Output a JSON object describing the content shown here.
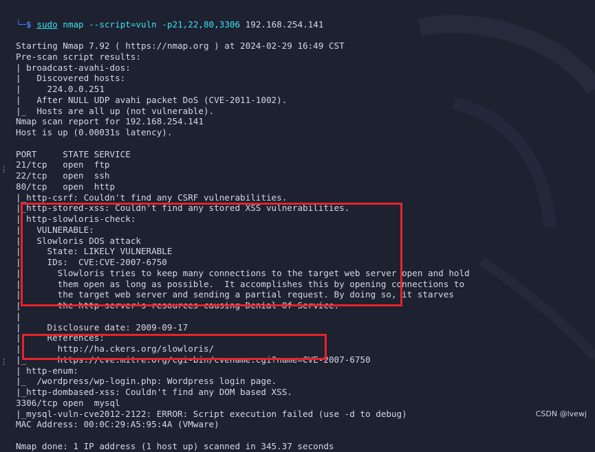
{
  "prompt": {
    "corner": "└─",
    "dollar": "$",
    "sudo": "sudo",
    "command": " nmap --script=vuln -p21,22,80,3306 ",
    "target": "192.168.254.141"
  },
  "lines": [
    {
      "prefix": "",
      "text": "Starting Nmap 7.92 ( https://nmap.org ) at 2024-02-29 16:49 CST"
    },
    {
      "prefix": "",
      "text": "Pre-scan script results:"
    },
    {
      "prefix": "| ",
      "text": "broadcast-avahi-dos:"
    },
    {
      "prefix": "|   ",
      "text": "Discovered hosts:"
    },
    {
      "prefix": "|     ",
      "text": "224.0.0.251"
    },
    {
      "prefix": "|   ",
      "text": "After NULL UDP avahi packet DoS (CVE-2011-1002)."
    },
    {
      "prefix": "|_  ",
      "text": "Hosts are all up (not vulnerable)."
    },
    {
      "prefix": "",
      "text": "Nmap scan report for 192.168.254.141"
    },
    {
      "prefix": "",
      "text": "Host is up (0.00031s latency)."
    },
    {
      "prefix": "",
      "text": ""
    },
    {
      "prefix": "",
      "text": "PORT     STATE SERVICE"
    },
    {
      "prefix": "",
      "text": "21/tcp   open  ftp"
    },
    {
      "prefix": "",
      "text": "22/tcp   open  ssh"
    },
    {
      "prefix": "",
      "text": "80/tcp   open  http"
    },
    {
      "prefix": "|_",
      "text": "http-csrf: Couldn't find any CSRF vulnerabilities."
    },
    {
      "prefix": "|_",
      "text": "http-stored-xss: Couldn't find any stored XSS vulnerabilities."
    },
    {
      "prefix": "| ",
      "text": "http-slowloris-check:"
    },
    {
      "prefix": "|   ",
      "text": "VULNERABLE:"
    },
    {
      "prefix": "|   ",
      "text": "Slowloris DOS attack"
    },
    {
      "prefix": "|     ",
      "text": "State: LIKELY VULNERABLE"
    },
    {
      "prefix": "|     ",
      "text": "IDs:  CVE:CVE-2007-6750"
    },
    {
      "prefix": "|       ",
      "text": "Slowloris tries to keep many connections to the target web server open and hold"
    },
    {
      "prefix": "|       ",
      "text": "them open as long as possible.  It accomplishes this by opening connections to"
    },
    {
      "prefix": "|       ",
      "text": "the target web server and sending a partial request. By doing so, it starves"
    },
    {
      "prefix": "|       ",
      "text": "the http server's resources causing Denial Of Service."
    },
    {
      "prefix": "|",
      "text": ""
    },
    {
      "prefix": "|     ",
      "text": "Disclosure date: 2009-09-17"
    },
    {
      "prefix": "|     ",
      "text": "References:"
    },
    {
      "prefix": "|       ",
      "text": "http://ha.ckers.org/slowloris/"
    },
    {
      "prefix": "|_      ",
      "text": "https://cve.mitre.org/cgi-bin/cvename.cgi?name=CVE-2007-6750"
    },
    {
      "prefix": "| ",
      "text": "http-enum:"
    },
    {
      "prefix": "|_  ",
      "text": "/wordpress/wp-login.php: Wordpress login page."
    },
    {
      "prefix": "|_",
      "text": "http-dombased-xss: Couldn't find any DOM based XSS."
    },
    {
      "prefix": "",
      "text": "3306/tcp open  mysql"
    },
    {
      "prefix": "|_",
      "text": "mysql-vuln-cve2012-2122: ERROR: Script execution failed (use -d to debug)"
    },
    {
      "prefix": "",
      "text": "MAC Address: 00:0C:29:A5:95:4A (VMware)"
    },
    {
      "prefix": "",
      "text": ""
    },
    {
      "prefix": "",
      "text": "Nmap done: 1 IP address (1 host up) scanned in 345.37 seconds"
    }
  ],
  "watermark": "CSDN @lvewj",
  "colors": {
    "background": "#1e2130",
    "text": "#d6d8e2",
    "command": "#3ce0f0",
    "prompt": "#3c7ff0",
    "highlight_box": "#e8232b"
  }
}
